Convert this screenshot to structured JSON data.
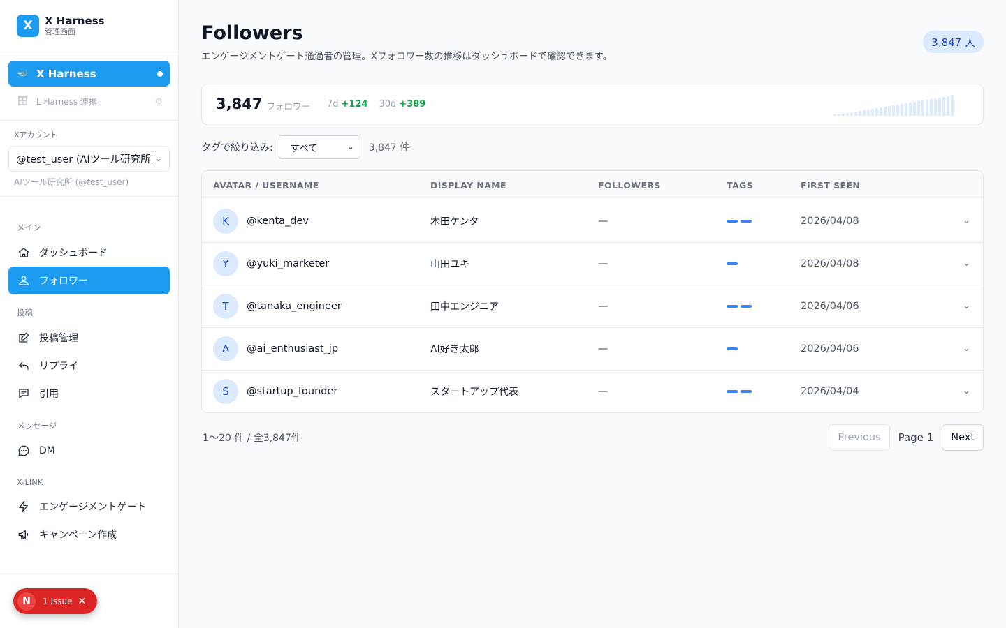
{
  "brand": {
    "logo": "X",
    "title": "X Harness",
    "subtitle": "管理画面"
  },
  "apps": {
    "active": {
      "label": "X Harness",
      "icon": "🐳"
    },
    "other": {
      "label": "L Harness 連携",
      "icon": "🗄"
    }
  },
  "account": {
    "label": "Xアカウント",
    "selected": "@test_user (AIツール研究所)",
    "sub": "AIツール研究所 (@test_user)"
  },
  "nav": {
    "sections": {
      "main": "メイン",
      "posts": "投稿",
      "messages": "メッセージ",
      "xlink": "X-LINK"
    },
    "items": {
      "dashboard": "ダッシュボード",
      "followers": "フォロワー",
      "post_manage": "投稿管理",
      "reply": "リプライ",
      "quote": "引用",
      "dm": "DM",
      "engagement_gate": "エンゲージメントゲート",
      "campaign": "キャンペーン作成"
    }
  },
  "issue": {
    "letter": "N",
    "label": "1 Issue",
    "close": "✕"
  },
  "header": {
    "title": "Followers",
    "description": "エンゲージメントゲート通過者の管理。Xフォロワー数の推移はダッシュボードで確認できます。",
    "badge": "3,847 人"
  },
  "stats": {
    "total": "3,847",
    "total_label": "フォロワー",
    "p7_label": "7d",
    "p7_delta": "+124",
    "p30_label": "30d",
    "p30_delta": "+389"
  },
  "sparkline": [
    2,
    2,
    3,
    4,
    5,
    6,
    7,
    8,
    9,
    10,
    11,
    12,
    13,
    14,
    15,
    16,
    17,
    18,
    19,
    20,
    21,
    22,
    23,
    24,
    25,
    26,
    27,
    28,
    30
  ],
  "filter": {
    "label": "タグで絞り込み:",
    "selected": "すべて",
    "count": "3,847 件"
  },
  "table": {
    "headers": [
      "AVATAR / USERNAME",
      "DISPLAY NAME",
      "FOLLOWERS",
      "TAGS",
      "FIRST SEEN"
    ],
    "rows": [
      {
        "initial": "K",
        "username": "@kenta_dev",
        "display": "木田ケンタ",
        "followers": "—",
        "tags": 2,
        "first_seen": "2026/04/08"
      },
      {
        "initial": "Y",
        "username": "@yuki_marketer",
        "display": "山田ユキ",
        "followers": "—",
        "tags": 1,
        "first_seen": "2026/04/08"
      },
      {
        "initial": "T",
        "username": "@tanaka_engineer",
        "display": "田中エンジニア",
        "followers": "—",
        "tags": 2,
        "first_seen": "2026/04/06"
      },
      {
        "initial": "A",
        "username": "@ai_enthusiast_jp",
        "display": "AI好き太郎",
        "followers": "—",
        "tags": 1,
        "first_seen": "2026/04/06"
      },
      {
        "initial": "S",
        "username": "@startup_founder",
        "display": "スタートアップ代表",
        "followers": "—",
        "tags": 2,
        "first_seen": "2026/04/04"
      }
    ]
  },
  "pager": {
    "info": "1〜20 件 / 全3,847件",
    "previous": "Previous",
    "page": "Page 1",
    "next": "Next"
  },
  "colors": {
    "accent": "#1d9bf0",
    "positive": "#16a34a",
    "tag": "#3b82f6",
    "issue": "#dc2626"
  }
}
